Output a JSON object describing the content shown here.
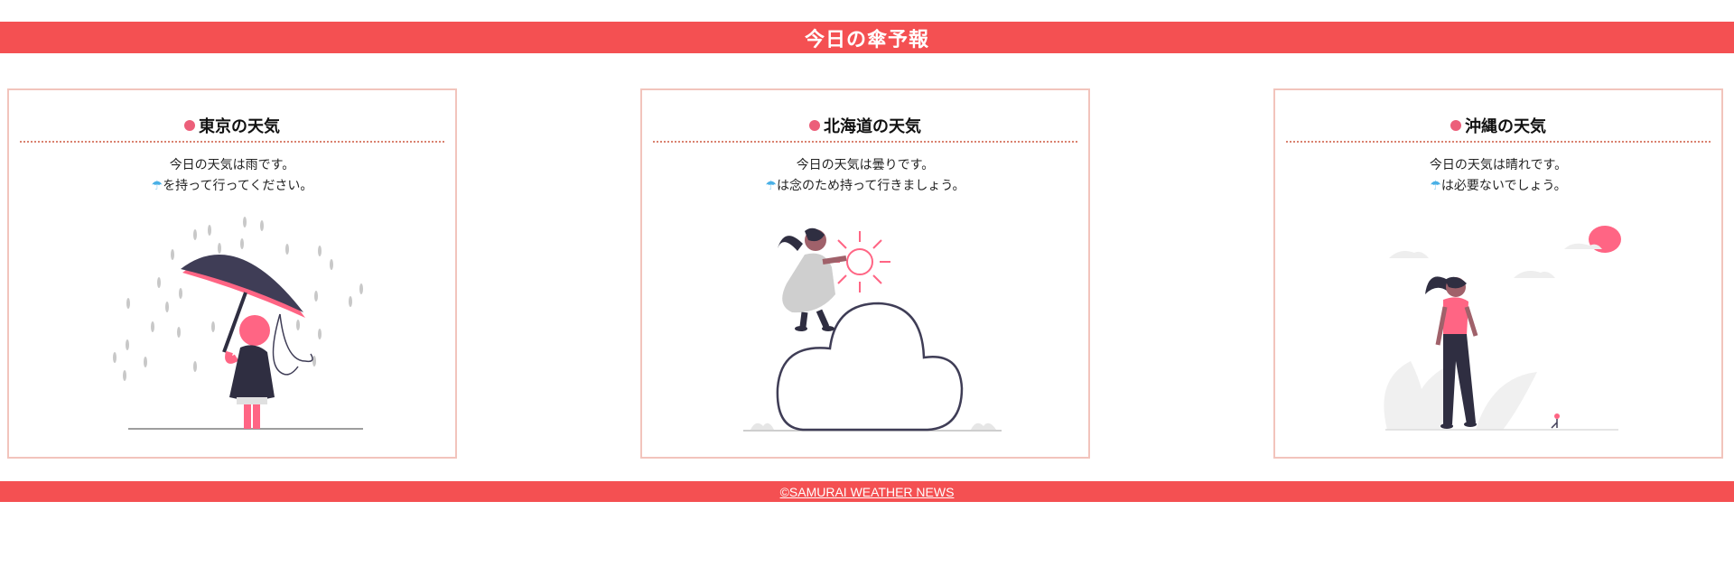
{
  "header": {
    "title": "今日の傘予報"
  },
  "cards": [
    {
      "title": "東京の天気",
      "line1": "今日の天気は雨です。",
      "umbrella_emoji": "☂",
      "line2": "を持って行ってください。"
    },
    {
      "title": "北海道の天気",
      "line1": "今日の天気は曇りです。",
      "umbrella_emoji": "☂",
      "line2": "は念のため持って行きましょう。"
    },
    {
      "title": "沖縄の天気",
      "line1": "今日の天気は晴れです。",
      "umbrella_emoji": "☂",
      "line2": "は必要ないでしょう。"
    }
  ],
  "footer": {
    "copyright": "©SAMURAI WEATHER NEWS"
  },
  "colors": {
    "accent": "#f45052",
    "pink": "#ff6584",
    "dark": "#3f3d56",
    "border": "#f2c4bc"
  },
  "icons": [
    "rain-illustration",
    "cloud-illustration",
    "sun-illustration"
  ]
}
